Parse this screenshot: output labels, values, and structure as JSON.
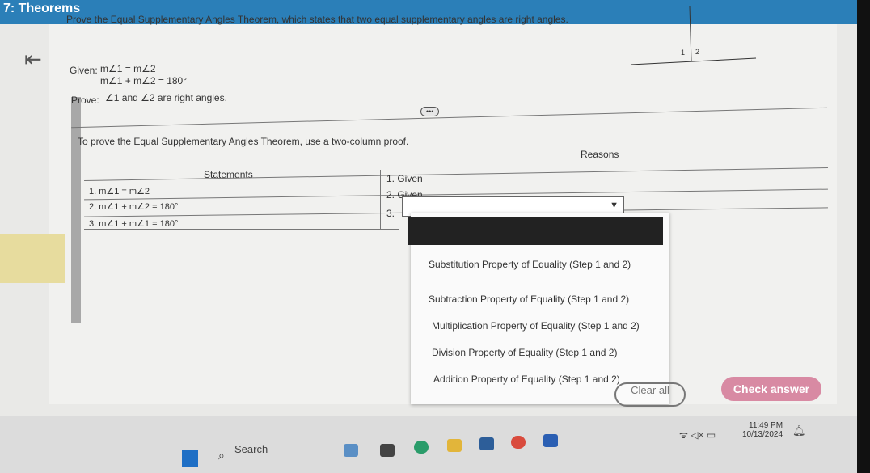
{
  "header": {
    "title": "7: Theorems"
  },
  "problem": {
    "prompt": "Prove the Equal Supplementary Angles Theorem, which states that two equal supplementary angles are right angles.",
    "given_label": "Given:",
    "given_1": "m∠1 = m∠2",
    "given_2": "m∠1 + m∠2 = 180°",
    "prove_label": "Prove:",
    "prove": "∠1 and ∠2 are right angles.",
    "diagram_labels": [
      "1",
      "2"
    ],
    "more_button": "•••"
  },
  "proof": {
    "intro": "To prove the Equal Supplementary Angles Theorem, use a two-column proof.",
    "statements_header": "Statements",
    "reasons_header": "Reasons",
    "statements": [
      "1. m∠1 = m∠2",
      "2. m∠1 + m∠2 = 180°",
      "3. m∠1 + m∠1 = 180°"
    ],
    "reasons": [
      "1. Given",
      "2. Given",
      "3."
    ]
  },
  "dropdown": {
    "options": [
      "Substitution Property of Equality (Step 1 and 2)",
      "Subtraction Property of Equality (Step 1 and 2)",
      "Multiplication Property of Equality (Step 1 and 2)",
      "Division Property of Equality (Step 1 and 2)",
      "Addition Property of Equality (Step 1 and 2)"
    ]
  },
  "buttons": {
    "clear_all": "Clear all",
    "check_answer": "Check answer"
  },
  "taskbar": {
    "search": "Search",
    "time": "11:49 PM",
    "date": "10/13/2024"
  },
  "colors": {
    "header": "#2b7fb8",
    "check_button": "#d88aa3"
  }
}
